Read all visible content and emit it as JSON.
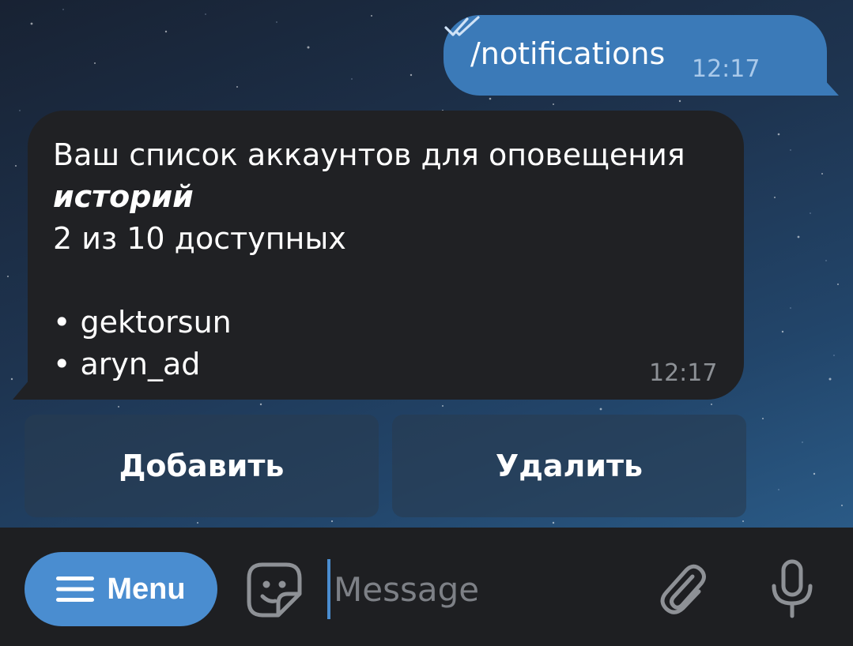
{
  "outgoing": {
    "text": "/notifications",
    "time": "12:17",
    "status_icon": "double-check-icon"
  },
  "incoming": {
    "line1": "Ваш список аккаунтов для оповещения",
    "line2": "историй",
    "line3": "2 из 10 доступных",
    "items": [
      "• gektorsun",
      "• aryn_ad"
    ],
    "time": "12:17"
  },
  "keyboard": {
    "add_label": "Добавить",
    "delete_label": "Удалить"
  },
  "composer": {
    "menu_label": "Menu",
    "menu_icon": "hamburger-icon",
    "placeholder": "Message",
    "value": ""
  },
  "colors": {
    "outgoing_bubble": "#3b7ab8",
    "incoming_bubble": "#202124",
    "accent": "#4a8dd0",
    "composer_bg": "#1e1f22"
  }
}
